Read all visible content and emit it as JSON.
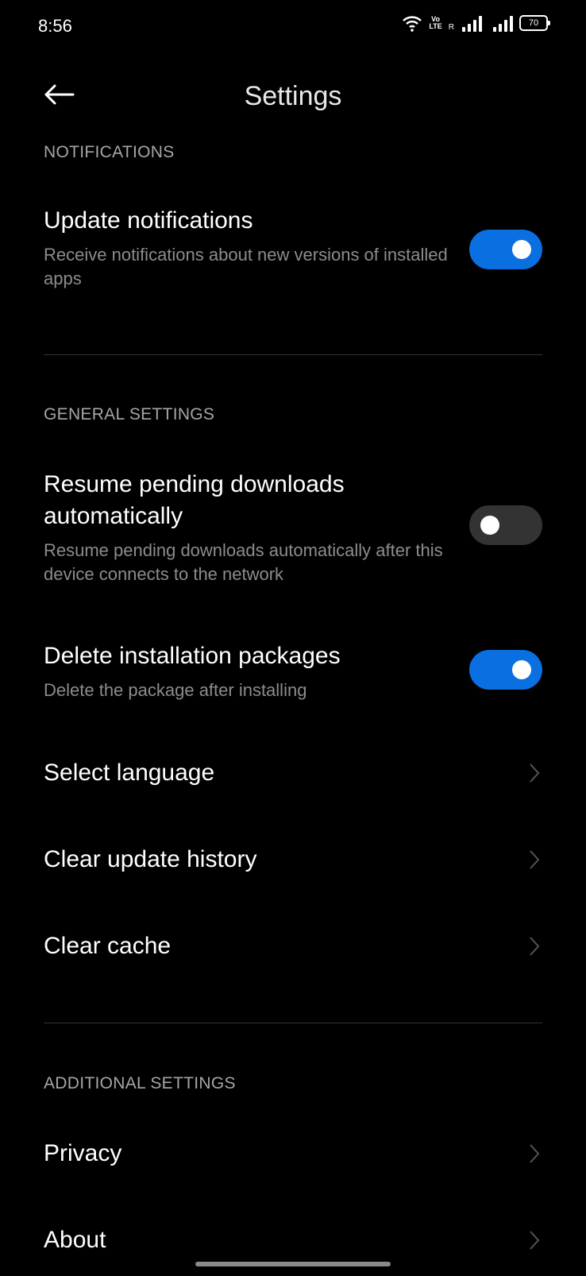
{
  "status_bar": {
    "time": "8:56",
    "volte_line1": "Vo",
    "volte_line2": "LTE",
    "roaming": "R",
    "battery": "70"
  },
  "header": {
    "title": "Settings",
    "back_icon": "arrow-left-icon"
  },
  "sections": {
    "notifications": {
      "label": "NOTIFICATIONS",
      "update_notifications": {
        "title": "Update notifications",
        "subtitle": "Receive notifications about new versions of installed apps",
        "enabled": true
      }
    },
    "general": {
      "label": "GENERAL SETTINGS",
      "resume_downloads": {
        "title": "Resume pending downloads automatically",
        "subtitle": "Resume pending downloads automatically after this device connects to the network",
        "enabled": false
      },
      "delete_packages": {
        "title": "Delete installation packages",
        "subtitle": "Delete the package after installing",
        "enabled": true
      },
      "select_language": {
        "title": "Select language"
      },
      "clear_history": {
        "title": "Clear update history"
      },
      "clear_cache": {
        "title": "Clear cache"
      }
    },
    "additional": {
      "label": "ADDITIONAL SETTINGS",
      "privacy": {
        "title": "Privacy"
      },
      "about": {
        "title": "About"
      }
    }
  },
  "colors": {
    "accent": "#0a6fe0",
    "background": "#000000",
    "toggle_off": "#333333"
  }
}
